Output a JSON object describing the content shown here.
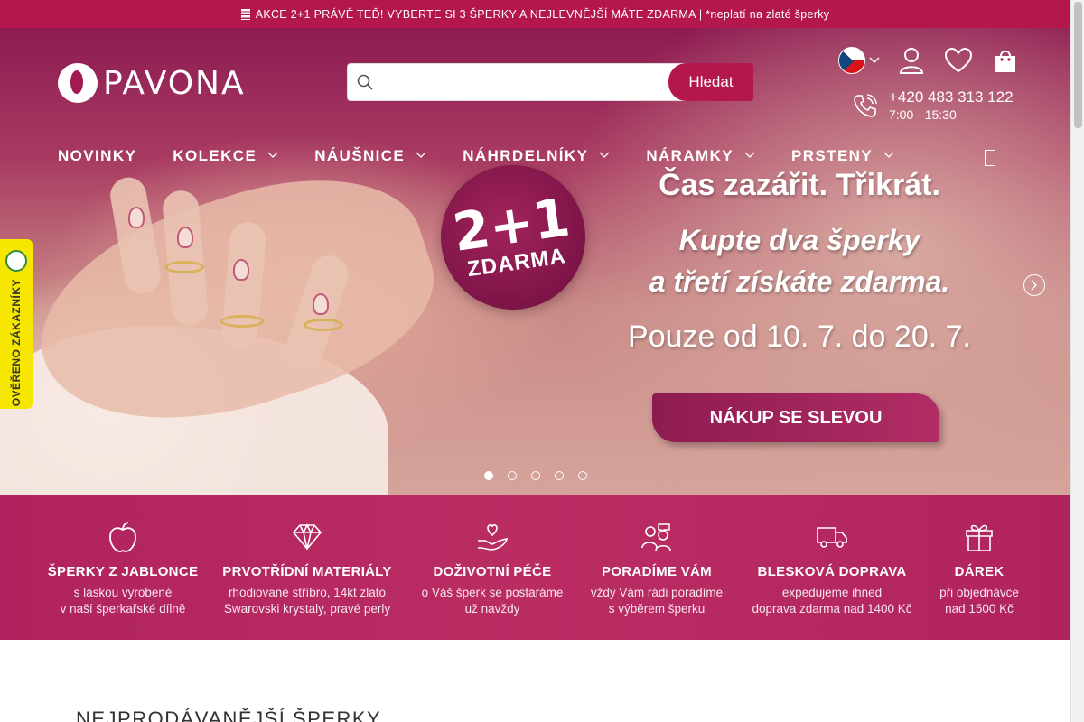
{
  "promo": {
    "text": "AKCE 2+1 PRÁVĚ TEĎ! VYBERTE SI 3 ŠPERKY A NEJLEVNĚJŠÍ MÁTE ZDARMA | *neplatí na zlaté šperky"
  },
  "header": {
    "logo_text": "PAVONA",
    "search_placeholder": "",
    "search_button": "Hledat",
    "phone": "+420 483 313 122",
    "hours": "7:00 - 15:30",
    "icons": [
      "flag-cz-icon",
      "chevron-down-icon",
      "user-icon",
      "heart-icon",
      "cart-icon"
    ]
  },
  "nav": {
    "items": [
      {
        "label": "NOVINKY",
        "dropdown": false
      },
      {
        "label": "KOLEKCE",
        "dropdown": true
      },
      {
        "label": "NÁUŠNICE",
        "dropdown": true
      },
      {
        "label": "NÁHRDELNÍKY",
        "dropdown": true
      },
      {
        "label": "NÁRAMKY",
        "dropdown": true
      },
      {
        "label": "PRSTENY",
        "dropdown": true
      }
    ]
  },
  "hero": {
    "badge_big": "2+1",
    "badge_small": "ZDARMA",
    "title": "Čas zazářit. Třikrát.",
    "line1": "Kupte dva šperky",
    "line2": "a třetí získáte zdarma.",
    "date": "Pouze od 10. 7. do 20. 7.",
    "cta": "NÁKUP SE SLEVOU",
    "slide_count": 5,
    "active_slide": 1
  },
  "verified": {
    "text": "OVĚŘENO ZÁKAZNÍKY"
  },
  "features": [
    {
      "icon": "apple-icon",
      "title": "ŠPERKY Z JABLONCE",
      "line1": "s láskou vyrobené",
      "line2": "v naší šperkařské dílně"
    },
    {
      "icon": "diamond-icon",
      "title": "PRVOTŘÍDNÍ MATERIÁLY",
      "line1": "rhodiované stříbro, 14kt zlato",
      "line2": "Swarovski krystaly, pravé perly"
    },
    {
      "icon": "hand-heart-icon",
      "title": "DOŽIVOTNÍ PÉČE",
      "line1": "o Váš šperk se postaráme",
      "line2": "už navždy"
    },
    {
      "icon": "support-people-icon",
      "title": "PORADÍME VÁM",
      "line1": "vždy Vám rádi poradíme",
      "line2": "s výběrem šperku"
    },
    {
      "icon": "truck-icon",
      "title": "BLESKOVÁ DOPRAVA",
      "line1": "expedujeme ihned",
      "line2": "doprava zdarma nad 1400 Kč"
    },
    {
      "icon": "gift-icon",
      "title": "DÁREK",
      "line1": "při objednávce",
      "line2": "nad 1500 Kč"
    }
  ],
  "section": {
    "title": "NEJPRODÁVANĚJŠÍ ŠPERKY"
  },
  "colors": {
    "brand": "#b3174e",
    "feature_bg": "#b0235e",
    "verified_bg": "#f6e600"
  }
}
